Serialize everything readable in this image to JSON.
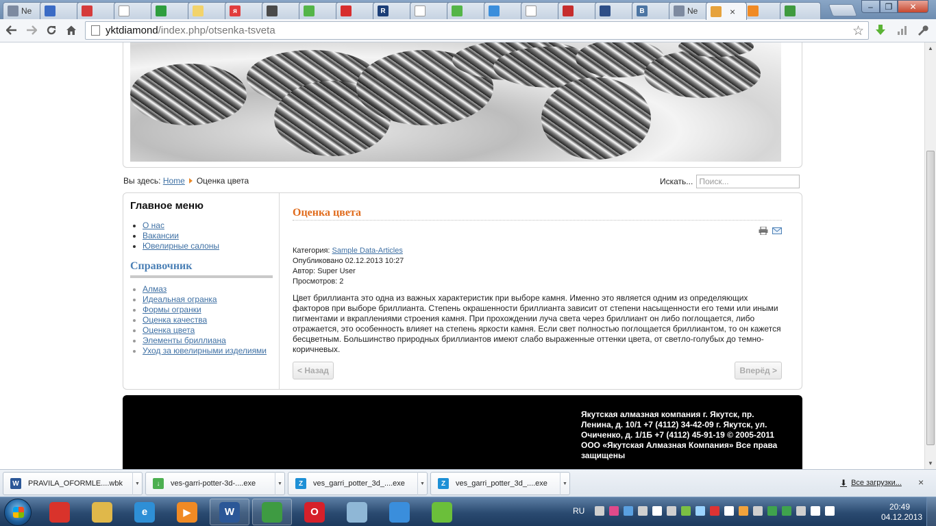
{
  "browser": {
    "tabs": [
      {
        "label": "Ne",
        "fav_text": "",
        "fav_color": "#7d8aa0"
      },
      {
        "label": "",
        "fav_text": "",
        "fav_color": "#3a6bc5"
      },
      {
        "label": "",
        "fav_text": "",
        "fav_color": "#d53b3b"
      },
      {
        "label": "",
        "fav_text": "",
        "fav_color": "#ffffff"
      },
      {
        "label": "",
        "fav_text": "",
        "fav_color": "#2e9e3e"
      },
      {
        "label": "",
        "fav_text": "",
        "fav_color": "#f2d36b"
      },
      {
        "label": "",
        "fav_text": "я",
        "fav_color": "#e13d3d"
      },
      {
        "label": "",
        "fav_text": "",
        "fav_color": "#4a4a4a"
      },
      {
        "label": "",
        "fav_text": "",
        "fav_color": "#54b548"
      },
      {
        "label": "",
        "fav_text": "",
        "fav_color": "#d72e2e"
      },
      {
        "label": "",
        "fav_text": "R",
        "fav_color": "#1b3e77"
      },
      {
        "label": "",
        "fav_text": "",
        "fav_color": "#ffffff"
      },
      {
        "label": "",
        "fav_text": "",
        "fav_color": "#54b548"
      },
      {
        "label": "",
        "fav_text": "",
        "fav_color": "#3a8edc"
      },
      {
        "label": "",
        "fav_text": "",
        "fav_color": "#ffffff"
      },
      {
        "label": "",
        "fav_text": "",
        "fav_color": "#c62d2d"
      },
      {
        "label": "",
        "fav_text": "",
        "fav_color": "#2d4e87"
      },
      {
        "label": "",
        "fav_text": "B",
        "fav_color": "#4c75a3"
      },
      {
        "label": "Ne",
        "fav_text": "",
        "fav_color": "#7d8aa0"
      },
      {
        "label": "",
        "fav_text": "",
        "fav_color": "#e6a23c",
        "active": true
      },
      {
        "label": "",
        "fav_text": "",
        "fav_color": "#f08a24"
      },
      {
        "label": "",
        "fav_text": "",
        "fav_color": "#3f9a3f"
      }
    ],
    "active_tab_close": "×",
    "window_controls": {
      "minimize": "‒",
      "maximize": "❐",
      "close": "✕"
    },
    "url": {
      "host": "yktdiamond",
      "path": "/index.php/otsenka-tsveta"
    },
    "icons": [
      "back-arrow-icon",
      "forward-arrow-icon",
      "reload-icon",
      "home-icon",
      "bookmark-star-icon",
      "download-extension-icon",
      "stats-extension-icon",
      "wrench-menu-icon"
    ]
  },
  "page": {
    "breadcrumb": {
      "prefix": "Вы здесь:",
      "home": "Home",
      "current": "Оценка цвета"
    },
    "search": {
      "label": "Искать...",
      "placeholder": "Поиск..."
    },
    "main_menu": {
      "title": "Главное меню",
      "items": [
        "О нас",
        "Вакансии",
        "Ювелирные салоны"
      ]
    },
    "reference": {
      "title": "Справочник",
      "items": [
        "Алмаз",
        "Идеальная огранка",
        "Формы огранки",
        "Оценка качества",
        "Оценка цвета",
        "Элементы бриллиана",
        "Уход за ювелирными изделиями"
      ]
    },
    "article": {
      "title": "Оценка цвета",
      "category_label": "Категория:",
      "category": "Sample Data-Articles",
      "published": "Опубликовано 02.12.2013 10:27",
      "author": "Автор: Super User",
      "views": "Просмотров: 2",
      "body": "Цвет бриллианта это одна из важных характеристик при выборе камня. Именно это является одним из определяющих факторов при выборе бриллианта. Степень окрашенности бриллианта зависит от степени насыщенности его теми или иными пигментами и вкраплениями строения камня. При прохождении луча света через бриллиант он либо поглощается, либо отражается, это особенность влияет на степень яркости камня. Если свет полностью поглощается бриллиантом, то он кажется бесцветным. Большинство природных бриллиантов имеют слабо выраженные оттенки цвета, от светло-голубых до темно-коричневых.",
      "prev": "< Назад",
      "next": "Вперёд >"
    },
    "footer": "Якутская алмазная компания г. Якутск, пр. Ленина, д. 10/1 +7 (4112) 34-42-09 г. Якутск, ул. Очиченко, д. 1/1Б +7 (4112) 45-91-19 © 2005-2011 ООО «Якутская Алмазная Компания» Все права защищены"
  },
  "downloads": {
    "items": [
      {
        "name": "PRAVILA_OFORMLE....wbk",
        "icon_color": "#2b5797",
        "icon_text": "W"
      },
      {
        "name": "ves-garri-potter-3d-....exe",
        "icon_color": "#4caf50",
        "icon_text": "↓"
      },
      {
        "name": "ves_garri_potter_3d_....exe",
        "icon_color": "#1e90d6",
        "icon_text": "Z"
      },
      {
        "name": "ves_garri_potter_3d_....exe",
        "icon_color": "#1e90d6",
        "icon_text": "Z"
      }
    ],
    "all_label": "Все загрузки...",
    "close": "×"
  },
  "taskbar": {
    "apps": [
      {
        "name": "acrobat-app",
        "color": "#d9332b",
        "text": "",
        "pinned": false
      },
      {
        "name": "explorer-app",
        "color": "#e0b84a",
        "text": "",
        "pinned": false
      },
      {
        "name": "internet-explorer-app",
        "color": "#2e8fd6",
        "text": "e",
        "pinned": false
      },
      {
        "name": "media-player-app",
        "color": "#f08a24",
        "text": "▶",
        "pinned": false
      },
      {
        "name": "word-app",
        "color": "#2b5797",
        "text": "W",
        "pinned": true
      },
      {
        "name": "chrome-app",
        "color": "#3e9b42",
        "text": "",
        "pinned": true
      },
      {
        "name": "opera-app",
        "color": "#d6202a",
        "text": "O",
        "pinned": false
      },
      {
        "name": "notepad-app",
        "color": "#8fb7d6",
        "text": "",
        "pinned": false
      },
      {
        "name": "paint-app",
        "color": "#3a8edc",
        "text": "",
        "pinned": false
      },
      {
        "name": "game-app",
        "color": "#6bbf3a",
        "text": "",
        "pinned": false
      }
    ],
    "lang": "RU",
    "tray_colors": [
      "#cfcfcf",
      "#e04a8a",
      "#5aa0e0",
      "#cfcfcf",
      "#ffffff",
      "#cfcfcf",
      "#7bc043",
      "#9ad3ff",
      "#d33",
      "#ffffff",
      "#f2a33c",
      "#cfcfcf",
      "#3fa34d",
      "#3fa34d",
      "#cfcfcf",
      "#ffffff",
      "#ffffff"
    ],
    "time": "20:49",
    "date": "04.12.2013"
  }
}
